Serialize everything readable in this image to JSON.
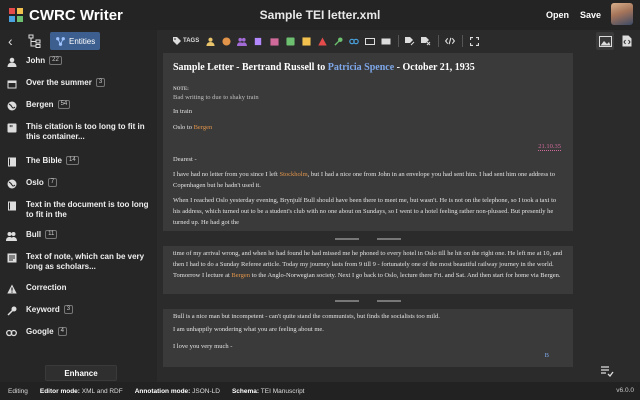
{
  "app": {
    "title": "CWRC Writer",
    "document_title": "Sample TEI letter.xml",
    "open_label": "Open",
    "save_label": "Save"
  },
  "sidebar": {
    "entities_tab_label": "Entities",
    "items": [
      {
        "label": "John",
        "count": "22",
        "icon": "person-icon"
      },
      {
        "label": "Over the summer",
        "count": "3",
        "icon": "calendar-icon"
      },
      {
        "label": "Bergen",
        "count": "54",
        "icon": "globe-icon"
      },
      {
        "label": "This citation is too long to fit in this container...",
        "count": "",
        "icon": "quote-icon"
      },
      {
        "label": "The Bible",
        "count": "14",
        "icon": "book-icon"
      },
      {
        "label": "Oslo",
        "count": "7",
        "icon": "globe-icon"
      },
      {
        "label": "Text in the document is too long to fit in the",
        "count": "",
        "icon": "book-icon"
      },
      {
        "label": "Bull",
        "count": "11",
        "icon": "people-icon"
      },
      {
        "label": "Text of note, which can be very long as scholars...",
        "count": "",
        "icon": "note-icon"
      },
      {
        "label": "Correction",
        "count": "",
        "icon": "warning-icon"
      },
      {
        "label": "Keyword",
        "count": "3",
        "icon": "key-icon"
      },
      {
        "label": "Google",
        "count": "4",
        "icon": "link-icon"
      }
    ],
    "enhance_label": "Enhance"
  },
  "toolbar": {
    "tags_label": "TAGS"
  },
  "document": {
    "title_prefix": "Sample Letter - Bertrand Russell to ",
    "title_link": "Patricia Spence",
    "title_suffix": " - October 21, 1935",
    "note_label": "NOTE:",
    "note_text": "Bad writing to due to shaky train",
    "in_train": "In train",
    "oslo_prefix": "Oslo to ",
    "oslo_place": "Bergen",
    "date": "21.10.35",
    "salutation": "Dearest -",
    "para1_a": "I have had no letter from you since I left ",
    "para1_place": "Stockholm",
    "para1_b": ", but I had a nice one from John in an envelope you had sent him. I had sent him one address to Copenhagen but he hadn't used it.",
    "para2": "When I reached Oslo yesterday evening, Brynjulf Bull should have been there to meet me, but wasn't. He is not on the telephone, so I took a taxi to his address, which turned out to be a student's club with no one about on Sundays, so I went to a hotel feeling rather non-plussed. But presently he turned up. He had got the",
    "para3_a": "time of my arrival wrong, and when he had found he had missed me he phoned to every hotel in Oslo till he hit on the right one. He left me at 10, and then I had to do a Sunday Referee article. Today my journey lasts from 9 till 9 - fortunately one of the most beautiful railway journey in the world. Tomorrow I lecture at ",
    "para3_place": "Bergen",
    "para3_b": " to the Anglo-Norwegian society. Next I go back to Oslo, lecture there Fri. and Sat. And then start for home via Bergen.",
    "para4": "Bull is a nice man but incompetent - can't quite stand the communists, but finds the socialists too mild.",
    "para5": "I am unhappily wondering what you are feeling about me.",
    "closing": "I love you very much -",
    "signature": "B"
  },
  "status": {
    "mode": "Editing",
    "editor_mode_label": "Editor mode:",
    "editor_mode_value": "XML and RDF",
    "annotation_mode_label": "Annotation mode:",
    "annotation_mode_value": "JSON-LD",
    "schema_label": "Schema:",
    "schema_value": "TEI Manuscript",
    "version": "v6.0.0"
  },
  "colors": {
    "accent": "#3d5f8f",
    "link": "#7da7e8",
    "place": "#e1944a",
    "date": "#d06a9a"
  }
}
